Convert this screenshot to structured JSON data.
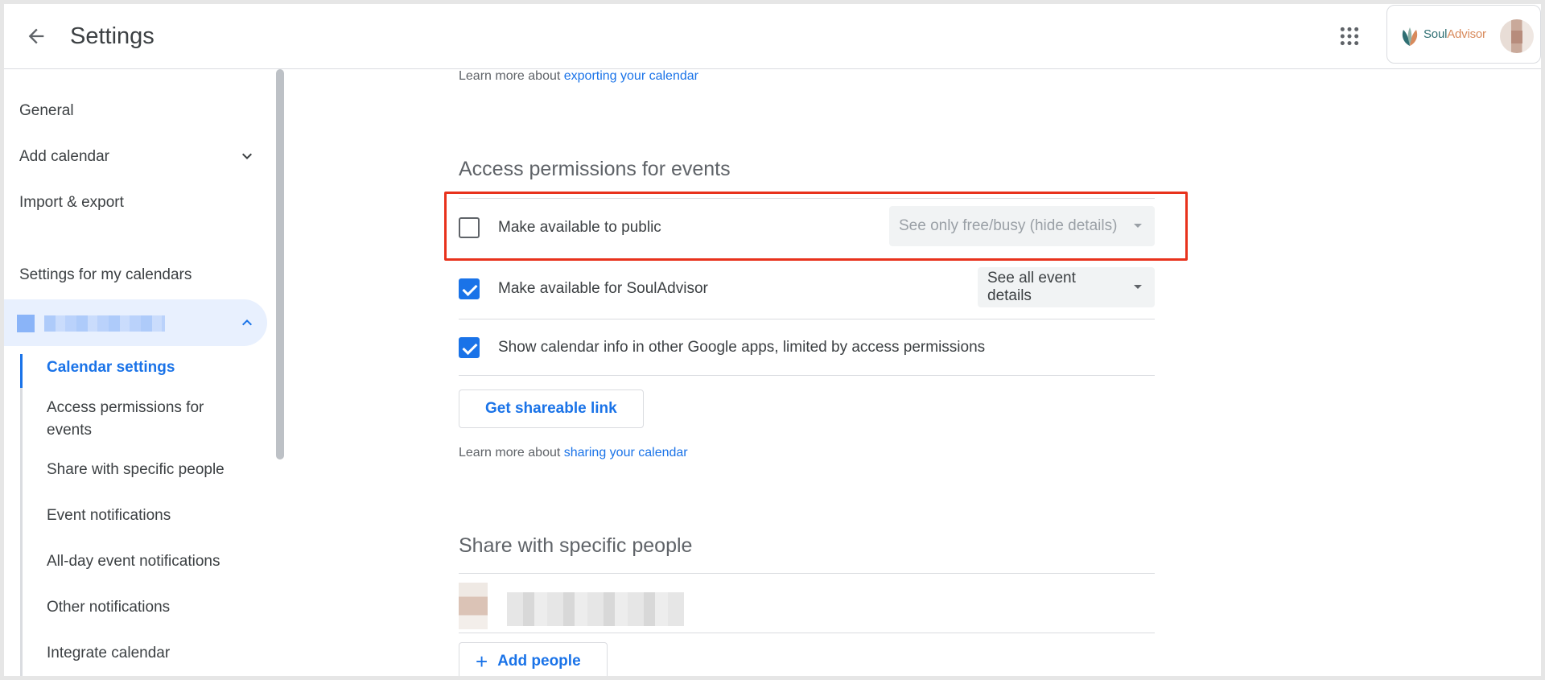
{
  "header": {
    "title": "Settings",
    "brand": {
      "name_part1": "Soul",
      "name_part2": "Advisor"
    }
  },
  "sidebar": {
    "items": [
      {
        "label": "General"
      },
      {
        "label": "Add calendar"
      },
      {
        "label": "Import & export"
      }
    ],
    "section_heading": "Settings for my calendars",
    "sub_items": [
      {
        "label": "Calendar settings"
      },
      {
        "label": "Access permissions for events"
      },
      {
        "label": "Share with specific people"
      },
      {
        "label": "Event notifications"
      },
      {
        "label": "All-day event notifications"
      },
      {
        "label": "Other notifications"
      },
      {
        "label": "Integrate calendar"
      }
    ]
  },
  "main": {
    "export_learn": {
      "prefix": "Learn more about ",
      "link": "exporting your calendar"
    },
    "access_section": {
      "title": "Access permissions for events",
      "public_row": {
        "label": "Make available to public",
        "checked": false,
        "select_value": "See only free/busy (hide details)"
      },
      "org_row": {
        "label": "Make available for SoulAdvisor",
        "checked": true,
        "select_value": "See all event details"
      },
      "google_apps_row": {
        "label": "Show calendar info in other Google apps, limited by access permissions",
        "checked": true
      },
      "share_link_button": "Get shareable link",
      "sharing_learn": {
        "prefix": "Learn more about ",
        "link": "sharing your calendar"
      }
    },
    "share_section": {
      "title": "Share with specific people",
      "add_people_button": "Add people"
    }
  },
  "colors": {
    "accent": "#1a73e8",
    "highlight": "#e8321c",
    "selected_bg": "#e8f0fe"
  }
}
